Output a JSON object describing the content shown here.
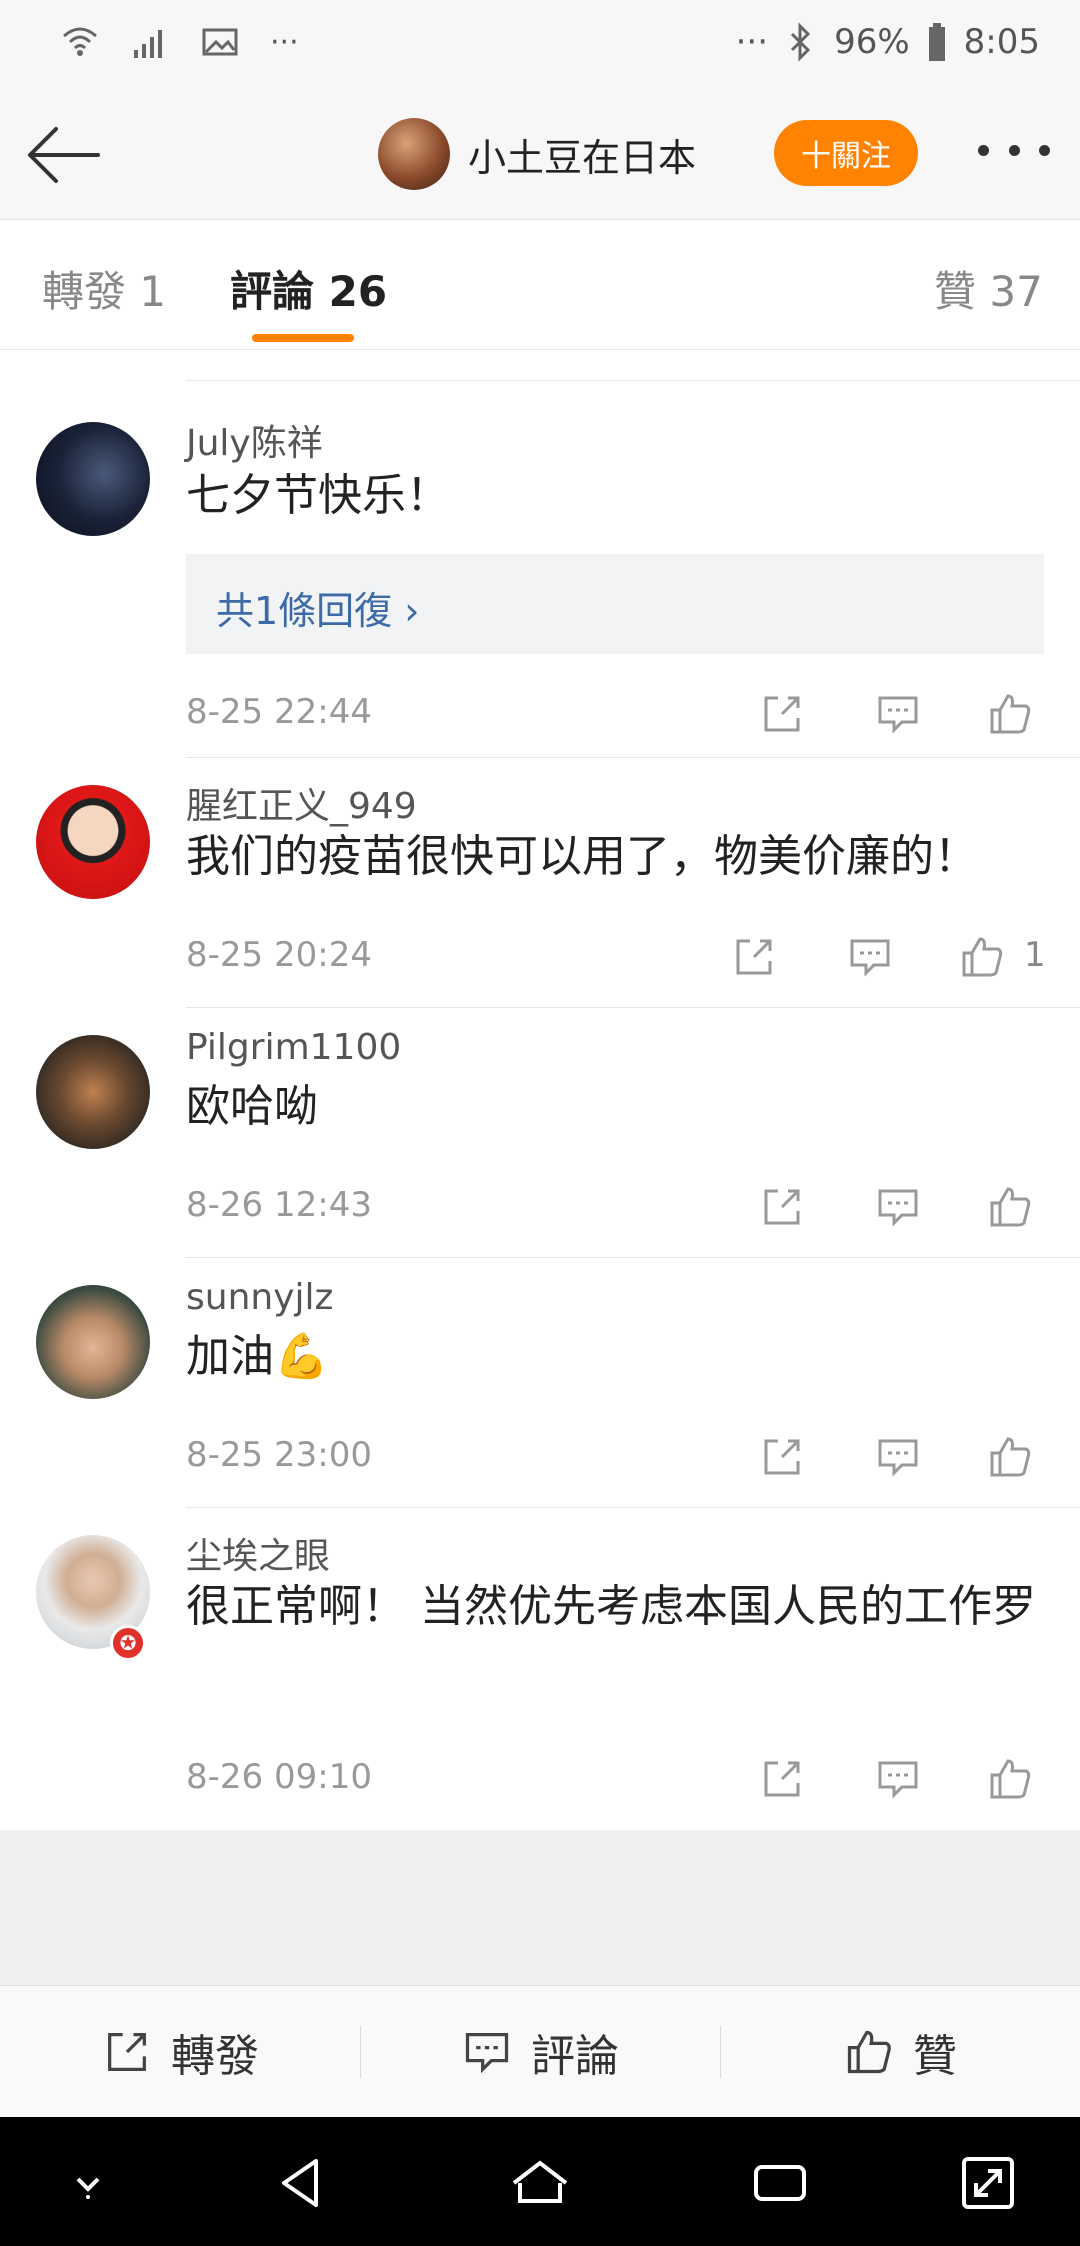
{
  "status_bar": {
    "battery": "96%",
    "time": "8:05",
    "overflow": "···"
  },
  "header": {
    "user_name": "小土豆在日本",
    "follow_label": "十關注"
  },
  "tabs": {
    "repost": "轉發 1",
    "comments": "評論 26",
    "likes": "贊 37"
  },
  "comments": [
    {
      "name": "July陈祥",
      "text": "七夕节快乐！",
      "reply_label": "共1條回復",
      "time": "8-25 22:44",
      "likes": ""
    },
    {
      "name": "腥红正义_949",
      "text": "我们的疫苗很快可以用了，物美价廉的！",
      "time": "8-25 20:24",
      "likes": "1"
    },
    {
      "name": "Pilgrim1100",
      "text": "欧哈呦",
      "time": "8-26 12:43",
      "likes": ""
    },
    {
      "name": "sunnyjlz",
      "text": "加油💪",
      "time": "8-25 23:00",
      "likes": ""
    },
    {
      "name": "尘埃之眼",
      "text": "很正常啊！ 当然优先考虑本国人民的工作罗",
      "time": "8-26 09:10",
      "likes": ""
    }
  ],
  "bottom_bar": {
    "repost": "轉發",
    "comment": "評論",
    "like": "贊"
  },
  "colors": {
    "accent": "#ff8200",
    "link": "#3d6ba8"
  }
}
